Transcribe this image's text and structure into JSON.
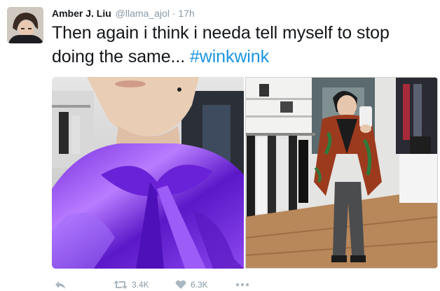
{
  "tweet": {
    "author_name": "Amber J. Liu",
    "author_handle": "@llama_ajol",
    "separator": "·",
    "timestamp": "17h",
    "text_main": "Then again i think i needa tell myself to stop doing the same... ",
    "hashtag": "#winkwink"
  },
  "actions": {
    "reply_icon": "reply-arrow-icon",
    "retweet_icon": "retweet-icon",
    "retweet_count": "3.4K",
    "like_icon": "heart-icon",
    "like_count": "6.3K",
    "more_icon": "more-dots-icon"
  },
  "colors": {
    "link": "#1b95e0",
    "meta": "#8899a6",
    "text": "#14171a"
  }
}
